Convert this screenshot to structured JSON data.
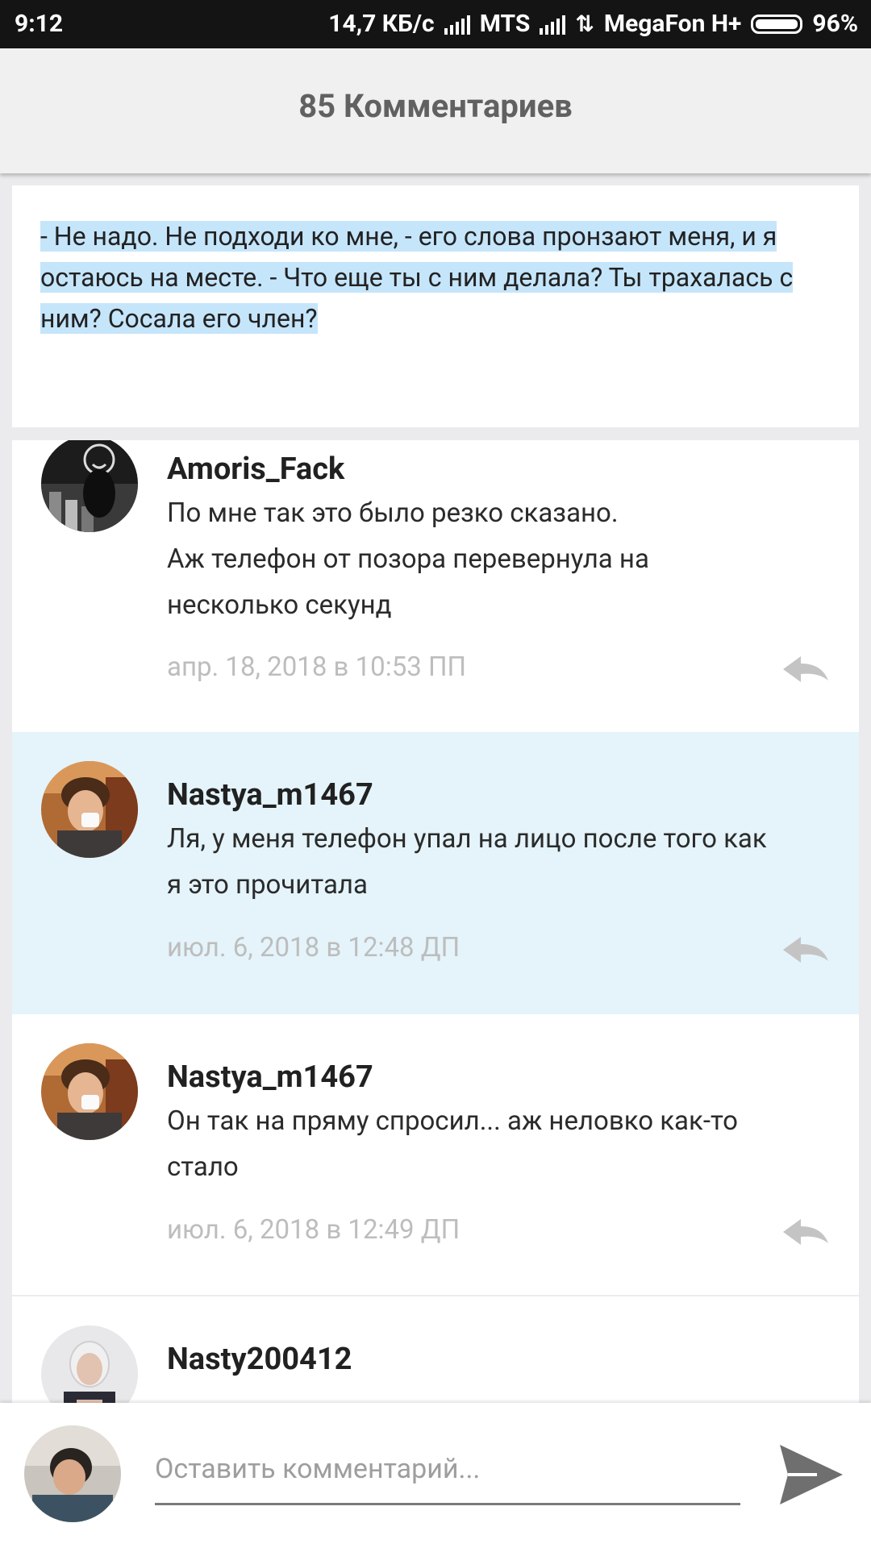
{
  "status_bar": {
    "time": "9:12",
    "speed": "14,7 КБ/с",
    "carrier1": "MTS",
    "carrier2": "MegaFon H+",
    "battery": "96%"
  },
  "header": {
    "title": "85 Комментариев"
  },
  "quote": {
    "text": "- Не надо. Не подходи ко мне, - его слова пронзают меня, и я остаюсь на месте. - Что еще ты с ним делала? Ты трахалась с ним? Сосала его член?"
  },
  "comments": [
    {
      "author": "Amoris_Fack",
      "text_lines": [
        "По мне так это было резко сказано.",
        "Аж телефон от позора перевернула на",
        "несколько секунд"
      ],
      "date": "апр. 18, 2018 в 10:53 ПП"
    },
    {
      "author": "Nastya_m1467",
      "text_lines": [
        "Ля, у меня телефон упал на лицо после того как",
        "я это прочитала"
      ],
      "date": "июл. 6, 2018 в 12:48 ДП"
    },
    {
      "author": "Nastya_m1467",
      "text_lines": [
        "Он так на пряму спросил... аж неловко как-то",
        "стало"
      ],
      "date": "июл. 6, 2018 в 12:49 ДП"
    },
    {
      "author": "Nasty200412",
      "text_lines": [],
      "date": ""
    }
  ],
  "input": {
    "placeholder": "Оставить комментарий..."
  },
  "icons": {
    "reply": "reply-arrow-icon",
    "send": "send-icon"
  },
  "colors": {
    "highlight_bg": "#e4f4fa",
    "selection": "#c5e5fb",
    "date": "#bdbdbd"
  }
}
